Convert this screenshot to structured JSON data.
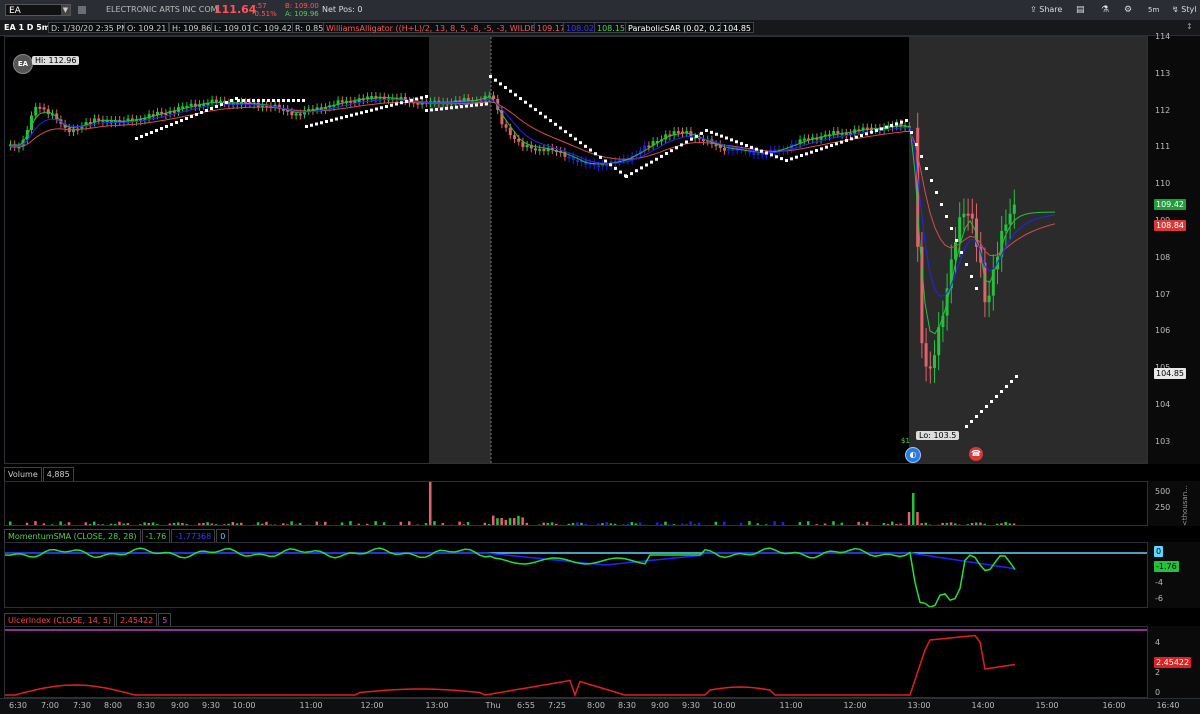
{
  "symbol": {
    "value": "EA",
    "company": "ELECTRONIC ARTS INC COM",
    "last": "111.64",
    "change": "-.57",
    "change_pct": "-0.51%",
    "bid": "B: 109.00",
    "ask": "A: 109.96",
    "net_pos": "Net Pos: 0"
  },
  "toolbar": {
    "share": "Share",
    "interval": "5m",
    "style": "Styl"
  },
  "info": {
    "label": "EA 1 D 5m",
    "date": "D: 1/30/20 2:35 PM",
    "open": "O: 109.21",
    "high": "H: 109.86",
    "low": "L: 109.01",
    "close": "C: 109.42",
    "range": "R: 0.85",
    "alligator": "WilliamsAlligator ((H+L)/2, 13, 8, 5, -8, -5, -3, WILDERS)",
    "jaw": "109.17",
    "teeth": "108.02",
    "lips": "108.15",
    "sar": "ParabolicSAR (0.02, 0.2)",
    "sar_val": "104.85"
  },
  "price_axis": {
    "ticks": [
      "114",
      "113",
      "112",
      "111",
      "110",
      "109",
      "108",
      "107",
      "106",
      "105",
      "104",
      "103"
    ],
    "tags": [
      {
        "text": "109.42",
        "bg": "#1f9e3a"
      },
      {
        "text": "108.84",
        "bg": "#d93838"
      },
      {
        "text": "104.85",
        "bg": "#e8e8e8"
      }
    ]
  },
  "annotations": {
    "hi": "Hi: 112.96",
    "lo": "Lo: 103.5",
    "small": "$1"
  },
  "volume": {
    "label": "Volume",
    "value": "4,885",
    "ticks": [
      "500",
      "250"
    ],
    "unit": "<thousan..."
  },
  "momentum": {
    "label": "MomentumSMA (CLOSE, 28, 28)",
    "v1": "-1.76",
    "v2": "-1.77368",
    "v3": "0",
    "ticks": [
      "0",
      "-2",
      "-4",
      "-6"
    ],
    "tag0": "0",
    "tag1": "-1.76"
  },
  "ulcer": {
    "label": "UlcerIndex (CLOSE, 14, 5)",
    "v1": "2.45422",
    "v2": "5",
    "ticks": [
      "4",
      "2",
      "0"
    ],
    "tag": "2.45422"
  },
  "time_axis": {
    "labels": [
      "6:30",
      "7:00",
      "7:30",
      "8:00",
      "8:30",
      "9:00",
      "9:30",
      "10:00",
      "11:00",
      "12:00",
      "13:00",
      "Thu",
      "6:55",
      "7:25",
      "8:00",
      "8:30",
      "9:00",
      "9:30",
      "10:00",
      "11:00",
      "12:00",
      "13:00",
      "14:00",
      "15:00",
      "16:00",
      "16:40"
    ]
  },
  "colors": {
    "up": "#22c33a",
    "down": "#e0636a",
    "blue": "#2020e0",
    "bg": "#000000",
    "shade": "#2b2b2b",
    "red_line": "#d94a4a"
  }
}
